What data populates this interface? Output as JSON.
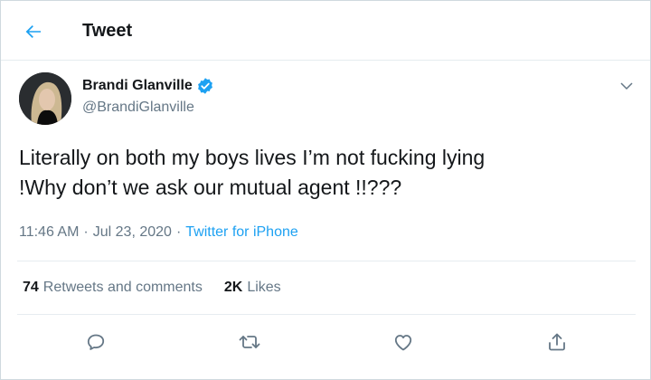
{
  "header": {
    "title": "Tweet"
  },
  "author": {
    "name": "Brandi Glanville",
    "handle": "@BrandiGlanville",
    "verified": true
  },
  "tweet": {
    "line1": "Literally on both my boys lives I’m not fucking lying",
    "line2": "!Why don’t we ask our mutual agent !!???"
  },
  "meta": {
    "time": "11:46 AM",
    "sep1": "·",
    "date": "Jul 23, 2020",
    "sep2": "·",
    "source": "Twitter for iPhone"
  },
  "stats": {
    "retweets": {
      "count": "74",
      "label": "Retweets and comments"
    },
    "likes": {
      "count": "2K",
      "label": "Likes"
    }
  },
  "icons": {
    "back": "arrow-left-icon",
    "verified": "verified-badge-icon",
    "menu": "chevron-down-icon",
    "reply": "reply-icon",
    "retweet": "retweet-icon",
    "like": "heart-icon",
    "share": "share-icon"
  },
  "colors": {
    "accent": "#1da1f2",
    "text": "#14171a",
    "secondary": "#657786",
    "border": "#e6ecf0"
  }
}
